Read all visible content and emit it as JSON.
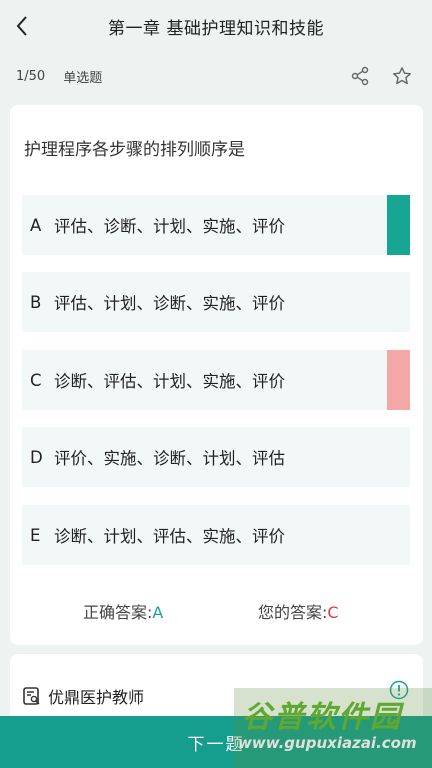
{
  "header": {
    "title": "第一章  基础护理知识和技能"
  },
  "meta": {
    "progress": "1/50",
    "question_type": "单选题"
  },
  "question": {
    "text": "护理程序各步骤的排列顺序是"
  },
  "options": [
    {
      "letter": "A",
      "text": "评估、诊断、计划、实施、评价",
      "state": "correct"
    },
    {
      "letter": "B",
      "text": "评估、计划、诊断、实施、评价",
      "state": "none"
    },
    {
      "letter": "C",
      "text": "诊断、评估、计划、实施、评价",
      "state": "wrong"
    },
    {
      "letter": "D",
      "text": "评价、实施、诊断、计划、评估",
      "state": "none"
    },
    {
      "letter": "E",
      "text": "诊断、计划、评估、实施、评价",
      "state": "none"
    }
  ],
  "answers": {
    "correct_label": "正确答案:",
    "correct_value": "A",
    "user_label": "您的答案:",
    "user_value": "C"
  },
  "teacher": {
    "name": "优鼎医护教师"
  },
  "footer": {
    "next_label": "下一题"
  },
  "watermark": {
    "title": "谷普软件园",
    "url": "www.gupuxiazai.com"
  },
  "colors": {
    "correct": "#17a594",
    "wrong": "#f4a7a7",
    "accent": "#159e8d"
  },
  "icons": {
    "back": "chevron-left-icon",
    "share": "share-icon",
    "favorite": "star-icon",
    "teacher": "search-doc-icon",
    "info": "info-icon"
  }
}
